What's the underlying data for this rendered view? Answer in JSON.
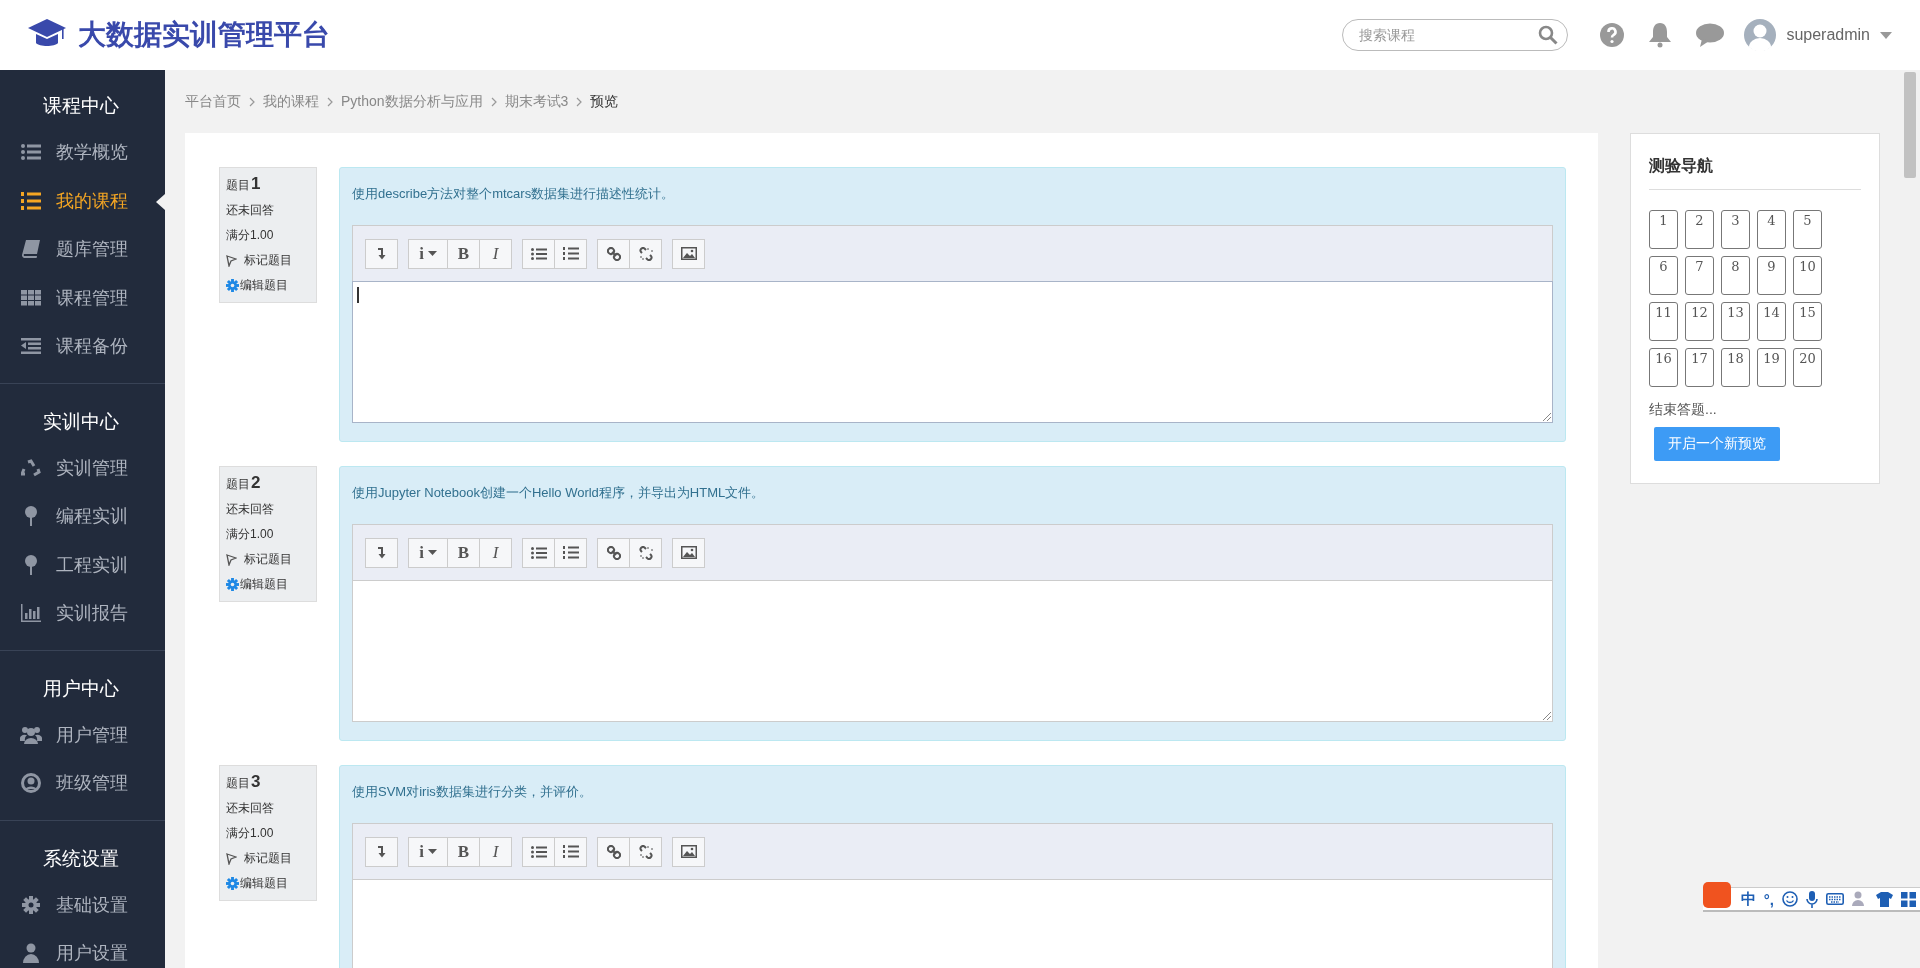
{
  "header": {
    "title": "大数据实训管理平台",
    "search": {
      "placeholder": "搜索课程"
    },
    "username": "superadmin"
  },
  "sidebar": {
    "sections": [
      {
        "title": "课程中心",
        "items": [
          {
            "label": "教学概览",
            "selected": false
          },
          {
            "label": "我的课程",
            "selected": true
          },
          {
            "label": "题库管理",
            "selected": false
          },
          {
            "label": "课程管理",
            "selected": false
          },
          {
            "label": "课程备份",
            "selected": false
          }
        ]
      },
      {
        "title": "实训中心",
        "items": [
          {
            "label": "实训管理",
            "selected": false
          },
          {
            "label": "编程实训",
            "selected": false
          },
          {
            "label": "工程实训",
            "selected": false
          },
          {
            "label": "实训报告",
            "selected": false
          }
        ]
      },
      {
        "title": "用户中心",
        "items": [
          {
            "label": "用户管理",
            "selected": false
          },
          {
            "label": "班级管理",
            "selected": false
          }
        ]
      },
      {
        "title": "系统设置",
        "items": [
          {
            "label": "基础设置",
            "selected": false
          },
          {
            "label": "用户设置",
            "selected": false
          }
        ]
      }
    ]
  },
  "breadcrumb": [
    "平台首页",
    "我的课程",
    "Python数据分析与应用",
    "期末考试3",
    "预览"
  ],
  "questions": [
    {
      "number_label": "题目",
      "number": "1",
      "status": "还未回答",
      "score": "满分1.00",
      "flag": "标记题目",
      "edit": "编辑题目",
      "text": "使用describe方法对整个mtcars数据集进行描述性统计。",
      "focused": true,
      "toolbar": [
        [
          {
            "kind": "collapse"
          }
        ],
        [
          {
            "kind": "para",
            "label": "i"
          },
          {
            "kind": "bold",
            "label": "B"
          },
          {
            "kind": "italic",
            "label": "I"
          }
        ],
        [
          {
            "kind": "ul"
          },
          {
            "kind": "ol"
          }
        ],
        [
          {
            "kind": "link"
          },
          {
            "kind": "unlink"
          }
        ],
        [
          {
            "kind": "image"
          }
        ]
      ]
    },
    {
      "number_label": "题目",
      "number": "2",
      "status": "还未回答",
      "score": "满分1.00",
      "flag": "标记题目",
      "edit": "编辑题目",
      "text": "使用Jupyter Notebook创建一个Hello World程序，并导出为HTML文件。",
      "focused": false,
      "toolbar": [
        [
          {
            "kind": "collapse"
          }
        ],
        [
          {
            "kind": "para",
            "label": "i"
          },
          {
            "kind": "bold",
            "label": "B"
          },
          {
            "kind": "italic",
            "label": "I"
          }
        ],
        [
          {
            "kind": "ul"
          },
          {
            "kind": "ol"
          }
        ],
        [
          {
            "kind": "link"
          },
          {
            "kind": "unlink"
          }
        ],
        [
          {
            "kind": "image"
          }
        ]
      ]
    },
    {
      "number_label": "题目",
      "number": "3",
      "status": "还未回答",
      "score": "满分1.00",
      "flag": "标记题目",
      "edit": "编辑题目",
      "text": "使用SVM对iris数据集进行分类，并评价。",
      "focused": false,
      "toolbar": [
        [
          {
            "kind": "collapse"
          }
        ],
        [
          {
            "kind": "para",
            "label": "i"
          },
          {
            "kind": "bold",
            "label": "B"
          },
          {
            "kind": "italic",
            "label": "I"
          }
        ],
        [
          {
            "kind": "ul"
          },
          {
            "kind": "ol"
          }
        ],
        [
          {
            "kind": "link"
          },
          {
            "kind": "unlink"
          }
        ],
        [
          {
            "kind": "image"
          }
        ]
      ]
    }
  ],
  "quiz_nav": {
    "title": "测验导航",
    "buttons": [
      "1",
      "2",
      "3",
      "4",
      "5",
      "6",
      "7",
      "8",
      "9",
      "10",
      "11",
      "12",
      "13",
      "14",
      "15",
      "16",
      "17",
      "18",
      "19",
      "20"
    ],
    "finish_link": "结束答题...",
    "new_preview_button": "开启一个新预览"
  },
  "ime_toolbar": {
    "mode": "中",
    "punctuation": "°,"
  }
}
